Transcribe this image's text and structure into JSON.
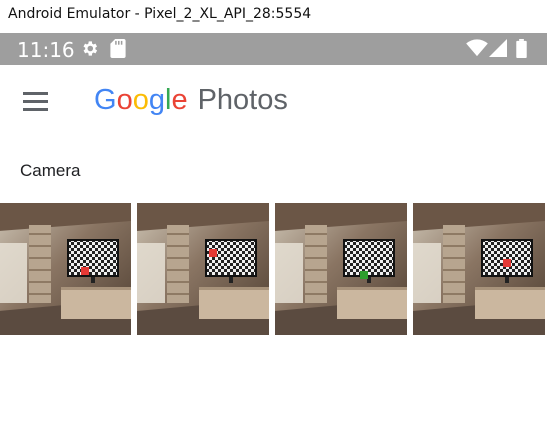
{
  "window": {
    "title": "Android Emulator - Pixel_2_XL_API_28:5554"
  },
  "status_bar": {
    "time": "11:16",
    "icons": [
      "gear-icon",
      "sd-card-icon",
      "wifi-icon",
      "signal-icon",
      "battery-icon"
    ]
  },
  "app_bar": {
    "menu_icon": "menu-icon",
    "logo_letters": [
      "G",
      "o",
      "o",
      "g",
      "l",
      "e"
    ],
    "logo_colors": [
      "#4285f4",
      "#ea4335",
      "#fbbc05",
      "#4285f4",
      "#34a853",
      "#ea4335"
    ],
    "logo_suffix": "Photos"
  },
  "section": {
    "title": "Camera"
  },
  "photos": [
    {
      "subject": "tv-checkerboard",
      "marker_color": "#e53935"
    },
    {
      "subject": "tv-checkerboard",
      "marker_color": "#e53935"
    },
    {
      "subject": "tv-checkerboard",
      "marker_color": "#2e9e2e"
    },
    {
      "subject": "tv-checkerboard",
      "marker_color": "#e53935"
    }
  ]
}
